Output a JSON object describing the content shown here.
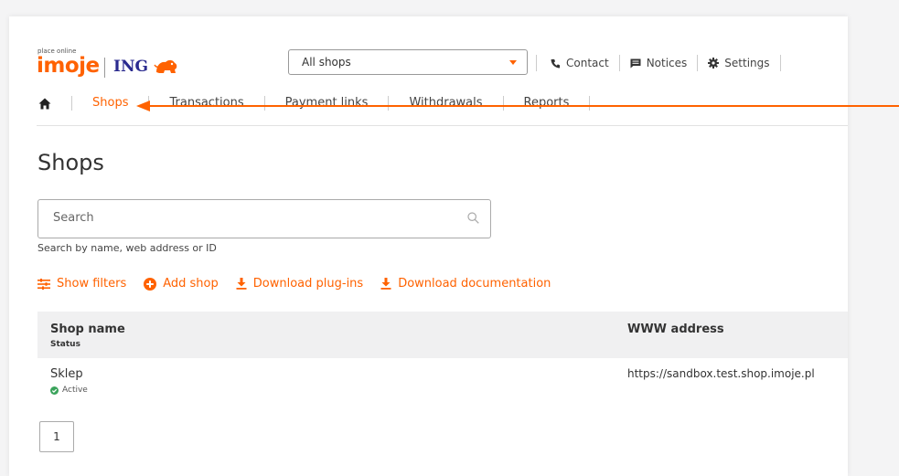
{
  "brand": {
    "tagline": "place online",
    "name": "imoje",
    "partner": "ING"
  },
  "header": {
    "shop_select": {
      "value": "All shops"
    },
    "links": [
      {
        "label": "Contact",
        "icon": "phone-icon"
      },
      {
        "label": "Notices",
        "icon": "message-icon"
      },
      {
        "label": "Settings",
        "icon": "gear-icon"
      }
    ]
  },
  "nav": {
    "home_icon": "home-icon",
    "items": [
      "Shops",
      "Transactions",
      "Payment links",
      "Withdrawals",
      "Reports"
    ],
    "active": "Shops"
  },
  "page": {
    "title": "Shops"
  },
  "search": {
    "placeholder": "Search",
    "value": "",
    "hint": "Search by name, web address or ID"
  },
  "actions": [
    {
      "label": "Show filters",
      "icon": "filter-sliders-icon"
    },
    {
      "label": "Add shop",
      "icon": "plus-circle-icon"
    },
    {
      "label": "Download plug-ins",
      "icon": "download-icon"
    },
    {
      "label": "Download documentation",
      "icon": "download-icon"
    }
  ],
  "table": {
    "columns": {
      "name": "Shop name",
      "name_sub": "Status",
      "url": "WWW address"
    },
    "rows": [
      {
        "name": "Sklep",
        "status": "Active",
        "url": "https://sandbox.test.shop.imoje.pl"
      }
    ]
  },
  "pagination": {
    "current": "1"
  },
  "colors": {
    "accent": "#ff6200",
    "success": "#3aa35b",
    "header_bg": "#f0f0f1",
    "ing_blue": "#2b2b8f"
  }
}
